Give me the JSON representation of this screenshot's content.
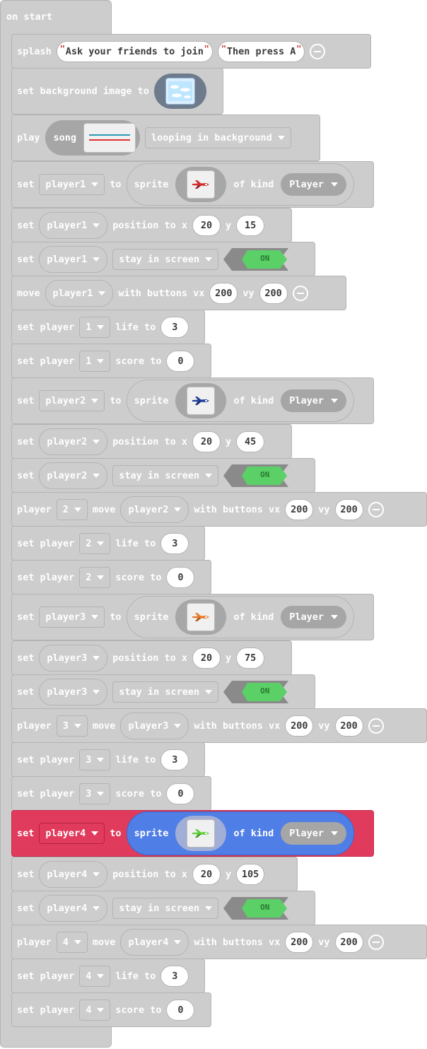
{
  "hat": {
    "label": "on start"
  },
  "common": {
    "set": "set",
    "to": "to",
    "sprite": "sprite",
    "of_kind": "of kind",
    "position_to_x": "position to x",
    "y": "y",
    "stay_in_screen": "stay in screen",
    "on": "ON",
    "move": "move",
    "with_buttons_vx": "with buttons vx",
    "vy": "vy",
    "set_player": "set player",
    "life_to": "life to",
    "score_to": "score to",
    "player": "player",
    "kind_player": "Player"
  },
  "splash": {
    "keyword": "splash",
    "title": "Ask your friends to join",
    "subtitle": "Then press A"
  },
  "background": {
    "label": "set background image to"
  },
  "music": {
    "play": "play",
    "song": "song",
    "mode": "looping in background"
  },
  "players": [
    {
      "var": "player1",
      "num": "1",
      "x": "20",
      "y": "15",
      "vx": "200",
      "vy": "200",
      "life": "3",
      "score": "0",
      "color": "#d22f2f"
    },
    {
      "var": "player2",
      "num": "2",
      "x": "20",
      "y": "45",
      "vx": "200",
      "vy": "200",
      "life": "3",
      "score": "0",
      "color": "#1e3e9a"
    },
    {
      "var": "player3",
      "num": "3",
      "x": "20",
      "y": "75",
      "vx": "200",
      "vy": "200",
      "life": "3",
      "score": "0",
      "color": "#e8792a"
    },
    {
      "var": "player4",
      "num": "4",
      "x": "20",
      "y": "105",
      "vx": "200",
      "vy": "200",
      "life": "3",
      "score": "0",
      "color": "#5fcf3e"
    }
  ],
  "move_labels": {
    "p1": "move"
  }
}
